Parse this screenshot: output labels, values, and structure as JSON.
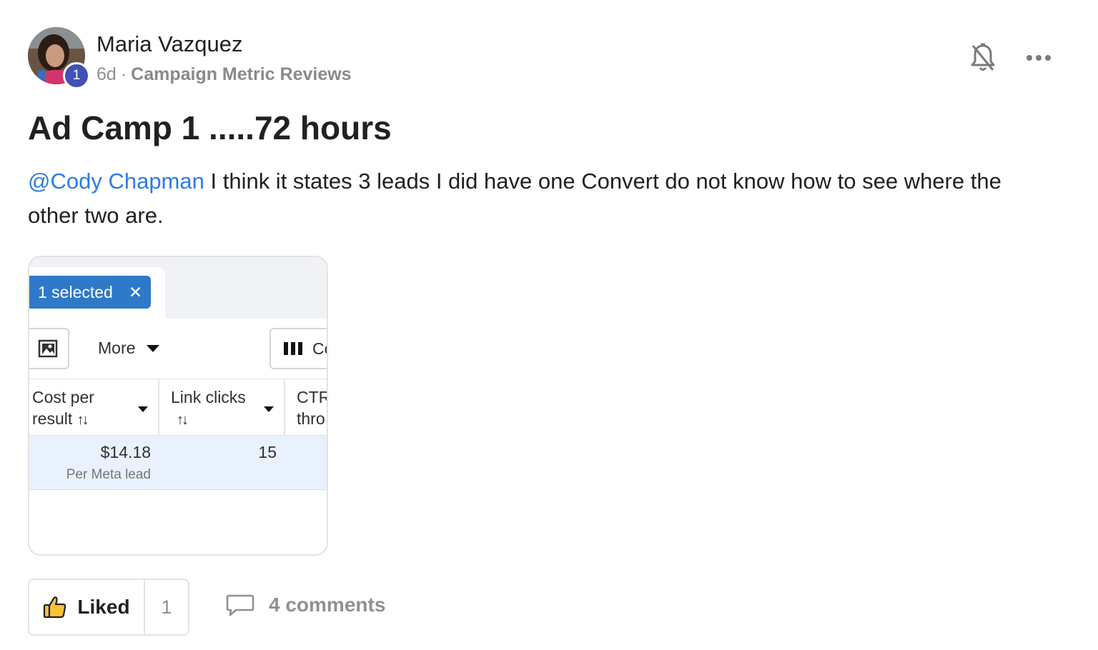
{
  "author": {
    "name": "Maria Vazquez",
    "level": "1",
    "time": "6d",
    "separator": "·",
    "category": "Campaign Metric Reviews"
  },
  "post": {
    "title": "Ad Camp 1 .....72 hours",
    "mention": "@Cody Chapman",
    "body": " I think it states 3 leads I did have one Convert do not know how to see where the other two are."
  },
  "attachment": {
    "selection_label": "1 selected",
    "close_glyph": "✕",
    "more_label": "More",
    "columns_label": "Co",
    "columns": [
      {
        "line1": "Cost per",
        "line2": "result"
      },
      {
        "line1": "Link clicks",
        "line2": ""
      },
      {
        "line1": "CTR",
        "line2": "thro"
      }
    ],
    "sort_glyph": "↑↓",
    "row": {
      "cost": "$14.18",
      "cost_sub": "Per Meta lead",
      "link_clicks": "15"
    }
  },
  "actions": {
    "like_label": "Liked",
    "like_count": "1",
    "comments_label": "4 comments"
  },
  "colors": {
    "mention": "#2d7be4",
    "level_badge": "#3f51b5",
    "selection_pill": "#2f79c9",
    "selected_row": "#e8f1fd"
  }
}
